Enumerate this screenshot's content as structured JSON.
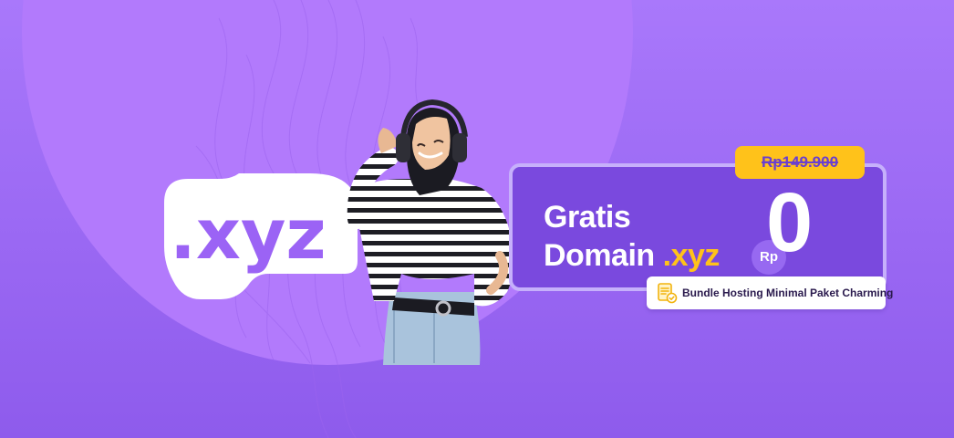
{
  "logo": {
    "text": ".xyz"
  },
  "promo": {
    "title_line1": "Gratis",
    "title_line2_prefix": "Domain ",
    "title_line2_accent": ".xyz",
    "currency": "Rp",
    "price": "0",
    "old_price": "Rp149.900",
    "bundle_note": "Bundle Hosting Minimal Paket Charming"
  },
  "icons": {
    "bundle": "document-check-icon"
  },
  "colors": {
    "background": "#a070f8",
    "card": "#7a49de",
    "card_border": "#c6b0fb",
    "accent_yellow": "#ffc21a",
    "logo_purple": "#9b63f5",
    "white": "#ffffff"
  }
}
